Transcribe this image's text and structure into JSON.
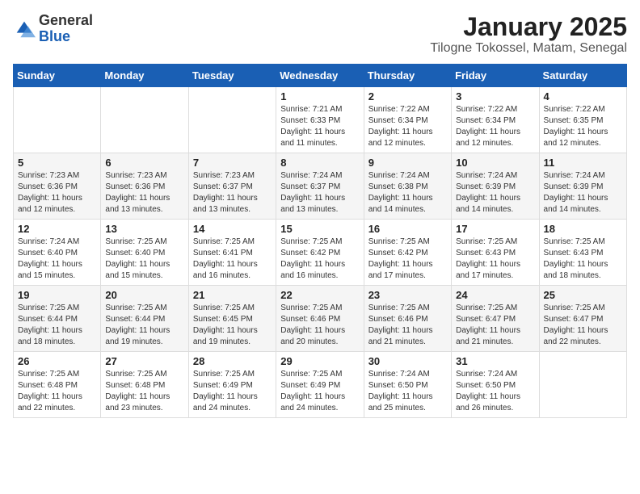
{
  "logo": {
    "general": "General",
    "blue": "Blue"
  },
  "header": {
    "month": "January 2025",
    "location": "Tilogne Tokossel, Matam, Senegal"
  },
  "weekdays": [
    "Sunday",
    "Monday",
    "Tuesday",
    "Wednesday",
    "Thursday",
    "Friday",
    "Saturday"
  ],
  "weeks": [
    [
      {
        "day": "",
        "sunrise": "",
        "sunset": "",
        "daylight": ""
      },
      {
        "day": "",
        "sunrise": "",
        "sunset": "",
        "daylight": ""
      },
      {
        "day": "",
        "sunrise": "",
        "sunset": "",
        "daylight": ""
      },
      {
        "day": "1",
        "sunrise": "Sunrise: 7:21 AM",
        "sunset": "Sunset: 6:33 PM",
        "daylight": "Daylight: 11 hours and 11 minutes."
      },
      {
        "day": "2",
        "sunrise": "Sunrise: 7:22 AM",
        "sunset": "Sunset: 6:34 PM",
        "daylight": "Daylight: 11 hours and 12 minutes."
      },
      {
        "day": "3",
        "sunrise": "Sunrise: 7:22 AM",
        "sunset": "Sunset: 6:34 PM",
        "daylight": "Daylight: 11 hours and 12 minutes."
      },
      {
        "day": "4",
        "sunrise": "Sunrise: 7:22 AM",
        "sunset": "Sunset: 6:35 PM",
        "daylight": "Daylight: 11 hours and 12 minutes."
      }
    ],
    [
      {
        "day": "5",
        "sunrise": "Sunrise: 7:23 AM",
        "sunset": "Sunset: 6:36 PM",
        "daylight": "Daylight: 11 hours and 12 minutes."
      },
      {
        "day": "6",
        "sunrise": "Sunrise: 7:23 AM",
        "sunset": "Sunset: 6:36 PM",
        "daylight": "Daylight: 11 hours and 13 minutes."
      },
      {
        "day": "7",
        "sunrise": "Sunrise: 7:23 AM",
        "sunset": "Sunset: 6:37 PM",
        "daylight": "Daylight: 11 hours and 13 minutes."
      },
      {
        "day": "8",
        "sunrise": "Sunrise: 7:24 AM",
        "sunset": "Sunset: 6:37 PM",
        "daylight": "Daylight: 11 hours and 13 minutes."
      },
      {
        "day": "9",
        "sunrise": "Sunrise: 7:24 AM",
        "sunset": "Sunset: 6:38 PM",
        "daylight": "Daylight: 11 hours and 14 minutes."
      },
      {
        "day": "10",
        "sunrise": "Sunrise: 7:24 AM",
        "sunset": "Sunset: 6:39 PM",
        "daylight": "Daylight: 11 hours and 14 minutes."
      },
      {
        "day": "11",
        "sunrise": "Sunrise: 7:24 AM",
        "sunset": "Sunset: 6:39 PM",
        "daylight": "Daylight: 11 hours and 14 minutes."
      }
    ],
    [
      {
        "day": "12",
        "sunrise": "Sunrise: 7:24 AM",
        "sunset": "Sunset: 6:40 PM",
        "daylight": "Daylight: 11 hours and 15 minutes."
      },
      {
        "day": "13",
        "sunrise": "Sunrise: 7:25 AM",
        "sunset": "Sunset: 6:40 PM",
        "daylight": "Daylight: 11 hours and 15 minutes."
      },
      {
        "day": "14",
        "sunrise": "Sunrise: 7:25 AM",
        "sunset": "Sunset: 6:41 PM",
        "daylight": "Daylight: 11 hours and 16 minutes."
      },
      {
        "day": "15",
        "sunrise": "Sunrise: 7:25 AM",
        "sunset": "Sunset: 6:42 PM",
        "daylight": "Daylight: 11 hours and 16 minutes."
      },
      {
        "day": "16",
        "sunrise": "Sunrise: 7:25 AM",
        "sunset": "Sunset: 6:42 PM",
        "daylight": "Daylight: 11 hours and 17 minutes."
      },
      {
        "day": "17",
        "sunrise": "Sunrise: 7:25 AM",
        "sunset": "Sunset: 6:43 PM",
        "daylight": "Daylight: 11 hours and 17 minutes."
      },
      {
        "day": "18",
        "sunrise": "Sunrise: 7:25 AM",
        "sunset": "Sunset: 6:43 PM",
        "daylight": "Daylight: 11 hours and 18 minutes."
      }
    ],
    [
      {
        "day": "19",
        "sunrise": "Sunrise: 7:25 AM",
        "sunset": "Sunset: 6:44 PM",
        "daylight": "Daylight: 11 hours and 18 minutes."
      },
      {
        "day": "20",
        "sunrise": "Sunrise: 7:25 AM",
        "sunset": "Sunset: 6:44 PM",
        "daylight": "Daylight: 11 hours and 19 minutes."
      },
      {
        "day": "21",
        "sunrise": "Sunrise: 7:25 AM",
        "sunset": "Sunset: 6:45 PM",
        "daylight": "Daylight: 11 hours and 19 minutes."
      },
      {
        "day": "22",
        "sunrise": "Sunrise: 7:25 AM",
        "sunset": "Sunset: 6:46 PM",
        "daylight": "Daylight: 11 hours and 20 minutes."
      },
      {
        "day": "23",
        "sunrise": "Sunrise: 7:25 AM",
        "sunset": "Sunset: 6:46 PM",
        "daylight": "Daylight: 11 hours and 21 minutes."
      },
      {
        "day": "24",
        "sunrise": "Sunrise: 7:25 AM",
        "sunset": "Sunset: 6:47 PM",
        "daylight": "Daylight: 11 hours and 21 minutes."
      },
      {
        "day": "25",
        "sunrise": "Sunrise: 7:25 AM",
        "sunset": "Sunset: 6:47 PM",
        "daylight": "Daylight: 11 hours and 22 minutes."
      }
    ],
    [
      {
        "day": "26",
        "sunrise": "Sunrise: 7:25 AM",
        "sunset": "Sunset: 6:48 PM",
        "daylight": "Daylight: 11 hours and 22 minutes."
      },
      {
        "day": "27",
        "sunrise": "Sunrise: 7:25 AM",
        "sunset": "Sunset: 6:48 PM",
        "daylight": "Daylight: 11 hours and 23 minutes."
      },
      {
        "day": "28",
        "sunrise": "Sunrise: 7:25 AM",
        "sunset": "Sunset: 6:49 PM",
        "daylight": "Daylight: 11 hours and 24 minutes."
      },
      {
        "day": "29",
        "sunrise": "Sunrise: 7:25 AM",
        "sunset": "Sunset: 6:49 PM",
        "daylight": "Daylight: 11 hours and 24 minutes."
      },
      {
        "day": "30",
        "sunrise": "Sunrise: 7:24 AM",
        "sunset": "Sunset: 6:50 PM",
        "daylight": "Daylight: 11 hours and 25 minutes."
      },
      {
        "day": "31",
        "sunrise": "Sunrise: 7:24 AM",
        "sunset": "Sunset: 6:50 PM",
        "daylight": "Daylight: 11 hours and 26 minutes."
      },
      {
        "day": "",
        "sunrise": "",
        "sunset": "",
        "daylight": ""
      }
    ]
  ]
}
